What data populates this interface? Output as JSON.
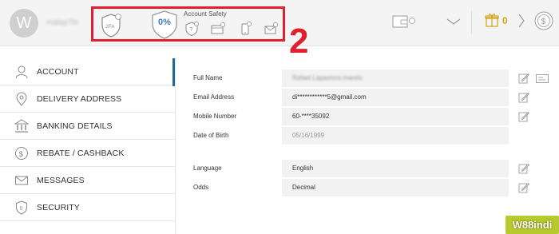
{
  "header": {
    "avatar_letter": "W",
    "username": "malay7fe",
    "account_safety": {
      "badge_2fa": "2FA",
      "percent": "0%",
      "title": "Account Safety"
    },
    "annotation": "2",
    "gift_count": "0"
  },
  "sidebar": {
    "items": [
      {
        "label": "ACCOUNT",
        "icon": "user-icon"
      },
      {
        "label": "DELIVERY ADDRESS",
        "icon": "location-pin-icon"
      },
      {
        "label": "BANKING DETAILS",
        "icon": "bank-icon"
      },
      {
        "label": "REBATE / CASHBACK",
        "icon": "dollar-coin-icon"
      },
      {
        "label": "MESSAGES",
        "icon": "envelope-icon"
      },
      {
        "label": "SECURITY",
        "icon": "shield-icon"
      }
    ]
  },
  "profile": {
    "full_name_label": "Full Name",
    "full_name_value": "Rafael Lapastora marelo",
    "email_label": "Email Address",
    "email_value": "di************5@gmail.com",
    "mobile_label": "Mobile Number",
    "mobile_value": "60-****35092",
    "dob_label": "Date of Birth",
    "dob_value": "05/16/1999",
    "language_label": "Language",
    "language_value": "English",
    "odds_label": "Odds",
    "odds_value": "Decimal"
  },
  "watermark": "W88indi",
  "colors": {
    "highlight_red": "#e0202e",
    "active_blue": "#1d6a94",
    "gift_gold": "#d4a51a",
    "watermark_green": "#b7c92d"
  }
}
